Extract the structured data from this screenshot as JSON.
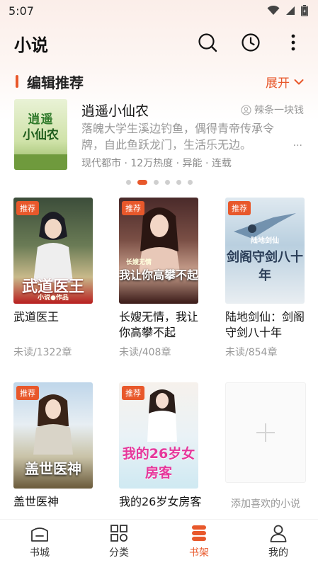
{
  "status_bar": {
    "time": "5:07"
  },
  "header": {
    "title": "小说"
  },
  "section": {
    "title": "编辑推荐",
    "expand_label": "展开"
  },
  "featured": {
    "title": "逍遥小仙农",
    "author": "辣条一块钱",
    "description": "落魄大学生溪边钓鱼，偶得青帝传承令牌，自此鱼跃龙门，生活乐无边。",
    "ellipsis": "...",
    "meta": "现代都市 · 12万热度 · 异能 · 连载",
    "cover_text_line1": "逍遥",
    "cover_text_line2": "小仙农"
  },
  "carousel": {
    "count": 6,
    "active_index": 1
  },
  "books": [
    {
      "tag": "推荐",
      "title": "武道医王",
      "progress": "未读/1322章",
      "cover_text": "武道医王",
      "cover_sub": "小说●作品"
    },
    {
      "tag": "推荐",
      "title": "长嫂无情，我让你高攀不起",
      "progress": "未读/408章",
      "cover_text": "我让你高攀不起",
      "cover_sub": "长嫂无情"
    },
    {
      "tag": "推荐",
      "title": "陆地剑仙：剑阁守剑八十年",
      "progress": "未读/854章",
      "cover_text": "剑阁守剑八十年",
      "cover_sub": "陆地剑仙"
    },
    {
      "tag": "推荐",
      "title": "盖世医神",
      "progress": "",
      "cover_text": "盖世医神",
      "cover_sub": ""
    },
    {
      "tag": "推荐",
      "title": "我的26岁女房客",
      "progress": "",
      "cover_text": "我的26岁女房客",
      "cover_sub": ""
    }
  ],
  "add_card": {
    "label": "添加喜欢的小说"
  },
  "nav": [
    {
      "label": "书城",
      "icon": "bookstore-icon"
    },
    {
      "label": "分类",
      "icon": "category-icon"
    },
    {
      "label": "书架",
      "icon": "bookshelf-icon"
    },
    {
      "label": "我的",
      "icon": "profile-icon"
    }
  ],
  "colors": {
    "accent": "#e8582b"
  }
}
